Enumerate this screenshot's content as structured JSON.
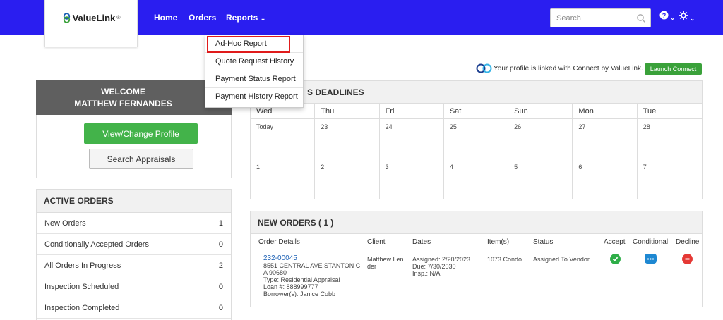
{
  "brand": {
    "name": "ValueLink",
    "mark": "®"
  },
  "nav": {
    "home": "Home",
    "orders": "Orders",
    "reports": "Reports",
    "reports_caret": "⌄"
  },
  "search": {
    "placeholder": "Search"
  },
  "reports_menu": [
    "Ad-Hoc Report",
    "Quote Request History",
    "Payment Status Report",
    "Payment History Report"
  ],
  "connect": {
    "message": "Your profile is linked with Connect by ValueLink.",
    "button": "Launch Connect"
  },
  "welcome": {
    "line1": "WELCOME",
    "line2": "MATTHEW FERNANDES",
    "profile_button": "View/Change Profile",
    "search_button": "Search Appraisals"
  },
  "active_orders": {
    "title": "ACTIVE ORDERS",
    "rows": [
      {
        "label": "New Orders",
        "count": "1"
      },
      {
        "label": "Conditionally Accepted Orders",
        "count": "0"
      },
      {
        "label": "All Orders In Progress",
        "count": "2"
      },
      {
        "label": "Inspection Scheduled",
        "count": "0"
      },
      {
        "label": "Inspection Completed",
        "count": "0"
      }
    ]
  },
  "deadlines": {
    "title": "S DEADLINES",
    "days": [
      "Wed",
      "Thu",
      "Fri",
      "Sat",
      "Sun",
      "Mon",
      "Tue"
    ],
    "week1": [
      "Today",
      "23",
      "24",
      "25",
      "26",
      "27",
      "28"
    ],
    "week2": [
      "1",
      "2",
      "3",
      "4",
      "5",
      "6",
      "7"
    ]
  },
  "new_orders": {
    "title": "NEW ORDERS ( 1 )",
    "columns": [
      "Order Details",
      "Client",
      "Dates",
      "Item(s)",
      "Status",
      "Accept",
      "Conditional",
      "Decline"
    ],
    "order": {
      "id": "232-00045",
      "address1": "8551 CENTRAL AVE STANTON C",
      "address2": "A 90680",
      "type": "Type: Residential Appraisal",
      "loan": "Loan #: 888999777",
      "borrower": "Borrower(s): Janice Cobb",
      "client1": "Matthew Len",
      "client2": "der",
      "assigned": "Assigned: 2/20/2023",
      "due": "Due: 7/30/2030",
      "insp": "Insp.: N/A",
      "items": "1073 Condo",
      "status": "Assigned To Vendor"
    }
  },
  "colors": {
    "topbar": "#2a1ef0",
    "accept": "#2eae48",
    "conditional": "#1e88d2",
    "decline": "#e53935",
    "highlight": "#e01b1b"
  }
}
